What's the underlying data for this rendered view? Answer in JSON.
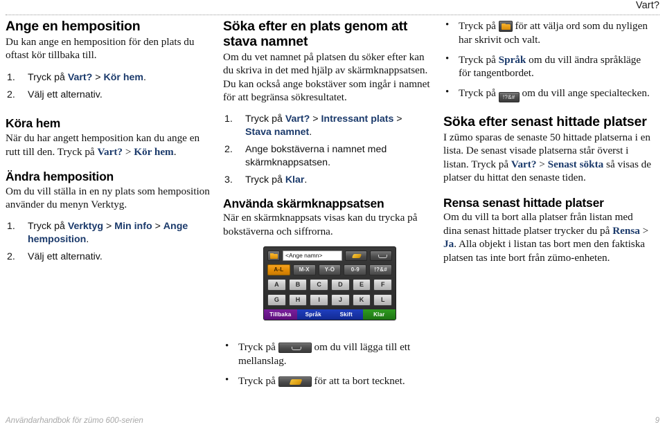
{
  "header": {
    "title": "Vart?"
  },
  "footer": {
    "left": "Användarhandbok för zümo 600-serien",
    "page": "9"
  },
  "colors": {
    "ui_link": "#1b3a6b",
    "accent_orange": "#e08a05",
    "footer_gray": "#a8a8a8"
  },
  "col_left": {
    "s1_title": "Ange en hemposition",
    "s1_body": "Du kan ange en hemposition för den plats du oftast kör tillbaka till.",
    "s1_steps": [
      {
        "num": "1.",
        "pre": "Tryck på ",
        "b1": "Vart?",
        "mid": " > ",
        "b2": "Kör hem",
        "post": "."
      },
      {
        "num": "2.",
        "pre": "Välj ett alternativ.",
        "b1": "",
        "mid": "",
        "b2": "",
        "post": ""
      }
    ],
    "s2_title": "Köra hem",
    "s2_body_pre": "När du har angett hemposition kan du ange en rutt till den. Tryck på ",
    "s2_b1": "Vart?",
    "s2_mid": " > ",
    "s2_b2": "Kör hem",
    "s2_post": ".",
    "s3_title": "Ändra hemposition",
    "s3_body": "Om du vill ställa in en ny plats som hemposition använder du menyn Verktyg.",
    "s3_steps": [
      {
        "num": "1.",
        "pre": "Tryck på ",
        "b1": "Verktyg",
        "mid": " > ",
        "b2": "Min info",
        "mid2": " > ",
        "b3": "Ange hemposition",
        "post": "."
      },
      {
        "num": "2.",
        "pre": "Välj ett alternativ.",
        "b1": "",
        "mid": "",
        "b2": "",
        "mid2": "",
        "b3": "",
        "post": ""
      }
    ]
  },
  "col_mid": {
    "s1_title": "Söka efter en plats genom att stava namnet",
    "s1_body": "Om du vet namnet på platsen du söker efter kan du skriva in det med hjälp av skärmknappsatsen. Du kan också ange bokstäver som ingår i namnet för att begränsa sökresultatet.",
    "s1_steps": [
      {
        "num": "1.",
        "pre": "Tryck på ",
        "b1": "Vart?",
        "mid": " > ",
        "b2": "Intressant plats",
        "mid2": " > ",
        "b3": "Stava namnet",
        "post": "."
      },
      {
        "num": "2.",
        "pre": "Ange bokstäverna i namnet med skärmknappsatsen.",
        "b1": "",
        "mid": "",
        "b2": "",
        "mid2": "",
        "b3": "",
        "post": ""
      },
      {
        "num": "3.",
        "pre": "Tryck på ",
        "b1": "Klar",
        "mid": "",
        "b2": "",
        "mid2": "",
        "b3": "",
        "post": "."
      }
    ],
    "s2_title": "Använda skärmknappsatsen",
    "s2_body": "När en skärmknappsats visas kan du trycka på bokstäverna och siffrorna."
  },
  "keypad": {
    "input_value": "<Ange namn>",
    "folder_icon": "folder-icon",
    "erase_icon": "erase-icon",
    "space_icon": "space-icon",
    "modes": [
      "A-L",
      "M-X",
      "Y-Ö",
      "0-9",
      "!?&#"
    ],
    "active_mode": "A-L",
    "row1": [
      "A",
      "B",
      "C",
      "D",
      "E",
      "F"
    ],
    "row2": [
      "G",
      "H",
      "I",
      "J",
      "K",
      "L"
    ],
    "footer_keys": [
      "Tillbaka",
      "Språk",
      "Skift",
      "Klar"
    ]
  },
  "col_right": {
    "bullets": [
      {
        "pre": "Tryck på ",
        "icon": "folder-key-icon",
        "post_a": " för att välja ord som du nyligen har skrivit och valt.",
        "bold": "",
        "post_b": ""
      },
      {
        "pre": "Tryck på ",
        "icon": "",
        "bold": "Språk",
        "post_a": " om du vill ändra språkläge för tangentbordet.",
        "post_b": ""
      },
      {
        "pre": "Tryck på ",
        "icon": "symbols-key-icon",
        "icon_label": "!?&#",
        "post_a": " om du vill ange specialtecken.",
        "bold": "",
        "post_b": ""
      }
    ],
    "s1_title": "Söka efter senast hittade platser",
    "s1_body_pre": "I zūmo sparas de senaste 50 hittade platserna i en lista. De senast visade platserna står överst i listan. Tryck på ",
    "s1_b1": "Vart?",
    "s1_mid": " > ",
    "s1_b2": "Senast sökta",
    "s1_post": " så visas de platser du hittat den senaste tiden.",
    "s2_title": "Rensa senast hittade platser",
    "s2_body_pre": "Om du vill ta bort alla platser från listan med dina senast hittade platser trycker du på ",
    "s2_b1": "Rensa",
    "s2_mid": " > ",
    "s2_b2": "Ja",
    "s2_post": ". Alla objekt i listan tas bort men den faktiska platsen tas inte bort från zümo-enheten."
  },
  "bottom_bullets": [
    {
      "pre": "Tryck på ",
      "icon": "space-key-icon",
      "post": " om du vill lägga till ett mellanslag."
    },
    {
      "pre": "Tryck på ",
      "icon": "backspace-key-icon",
      "post": " för att ta bort tecknet."
    }
  ]
}
